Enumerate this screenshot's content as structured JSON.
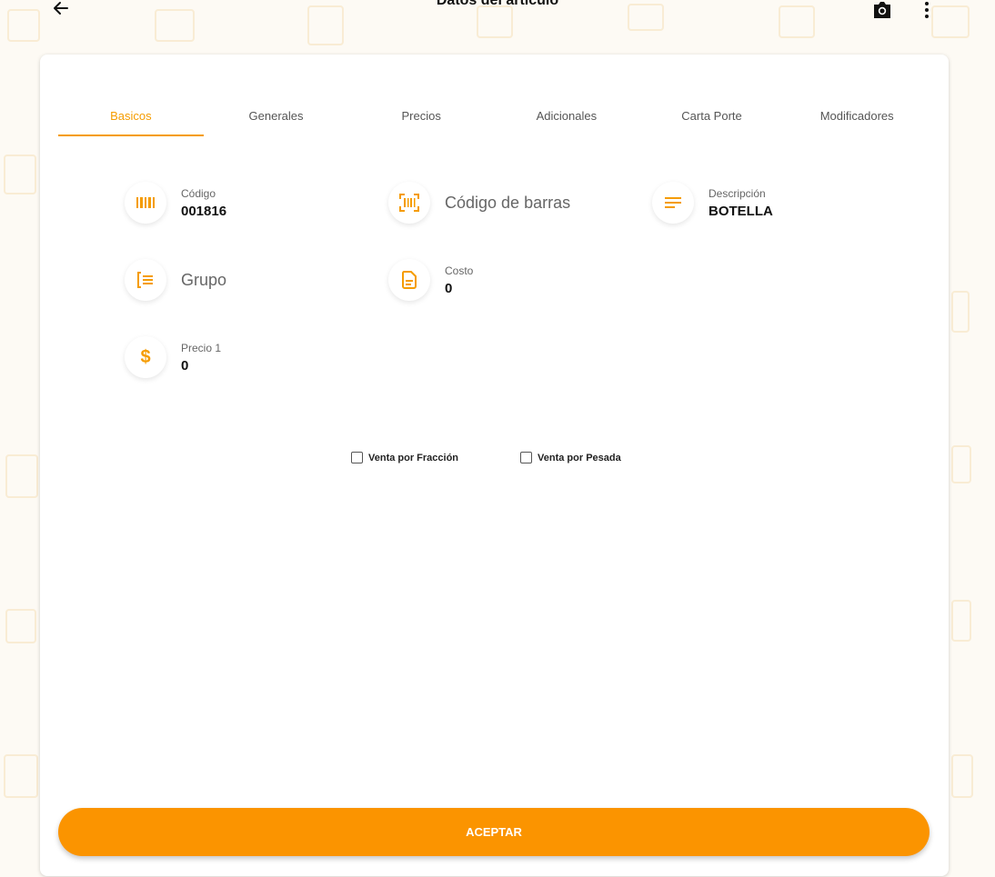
{
  "header": {
    "title": "Datos del artículo",
    "back_icon": "arrow-left-icon",
    "camera_icon": "camera-icon",
    "more_icon": "more-vertical-icon"
  },
  "tabs": [
    {
      "label": "Basicos",
      "active": true
    },
    {
      "label": "Generales",
      "active": false
    },
    {
      "label": "Precios",
      "active": false
    },
    {
      "label": "Adicionales",
      "active": false
    },
    {
      "label": "Carta Porte",
      "active": false
    },
    {
      "label": "Modificadores",
      "active": false
    }
  ],
  "fields": {
    "codigo": {
      "label": "Código",
      "value": "001816",
      "icon": "barcode-icon"
    },
    "codigo_barras": {
      "placeholder": "Código de barras",
      "icon": "barcode-scan-icon"
    },
    "descripcion": {
      "label": "Descripción",
      "value": "BOTELLA",
      "icon": "notes-icon"
    },
    "grupo": {
      "placeholder": "Grupo",
      "icon": "list-icon"
    },
    "costo": {
      "label": "Costo",
      "value": "0",
      "icon": "document-icon"
    },
    "precio1": {
      "label": "Precio 1",
      "value": "0",
      "icon": "dollar-icon"
    }
  },
  "checkboxes": [
    {
      "label": "Venta por Fracción",
      "checked": false
    },
    {
      "label": "Venta por Pesada",
      "checked": false
    }
  ],
  "actions": {
    "accept_label": "ACEPTAR"
  },
  "colors": {
    "accent": "#f59c00",
    "button": "#fb9400"
  }
}
